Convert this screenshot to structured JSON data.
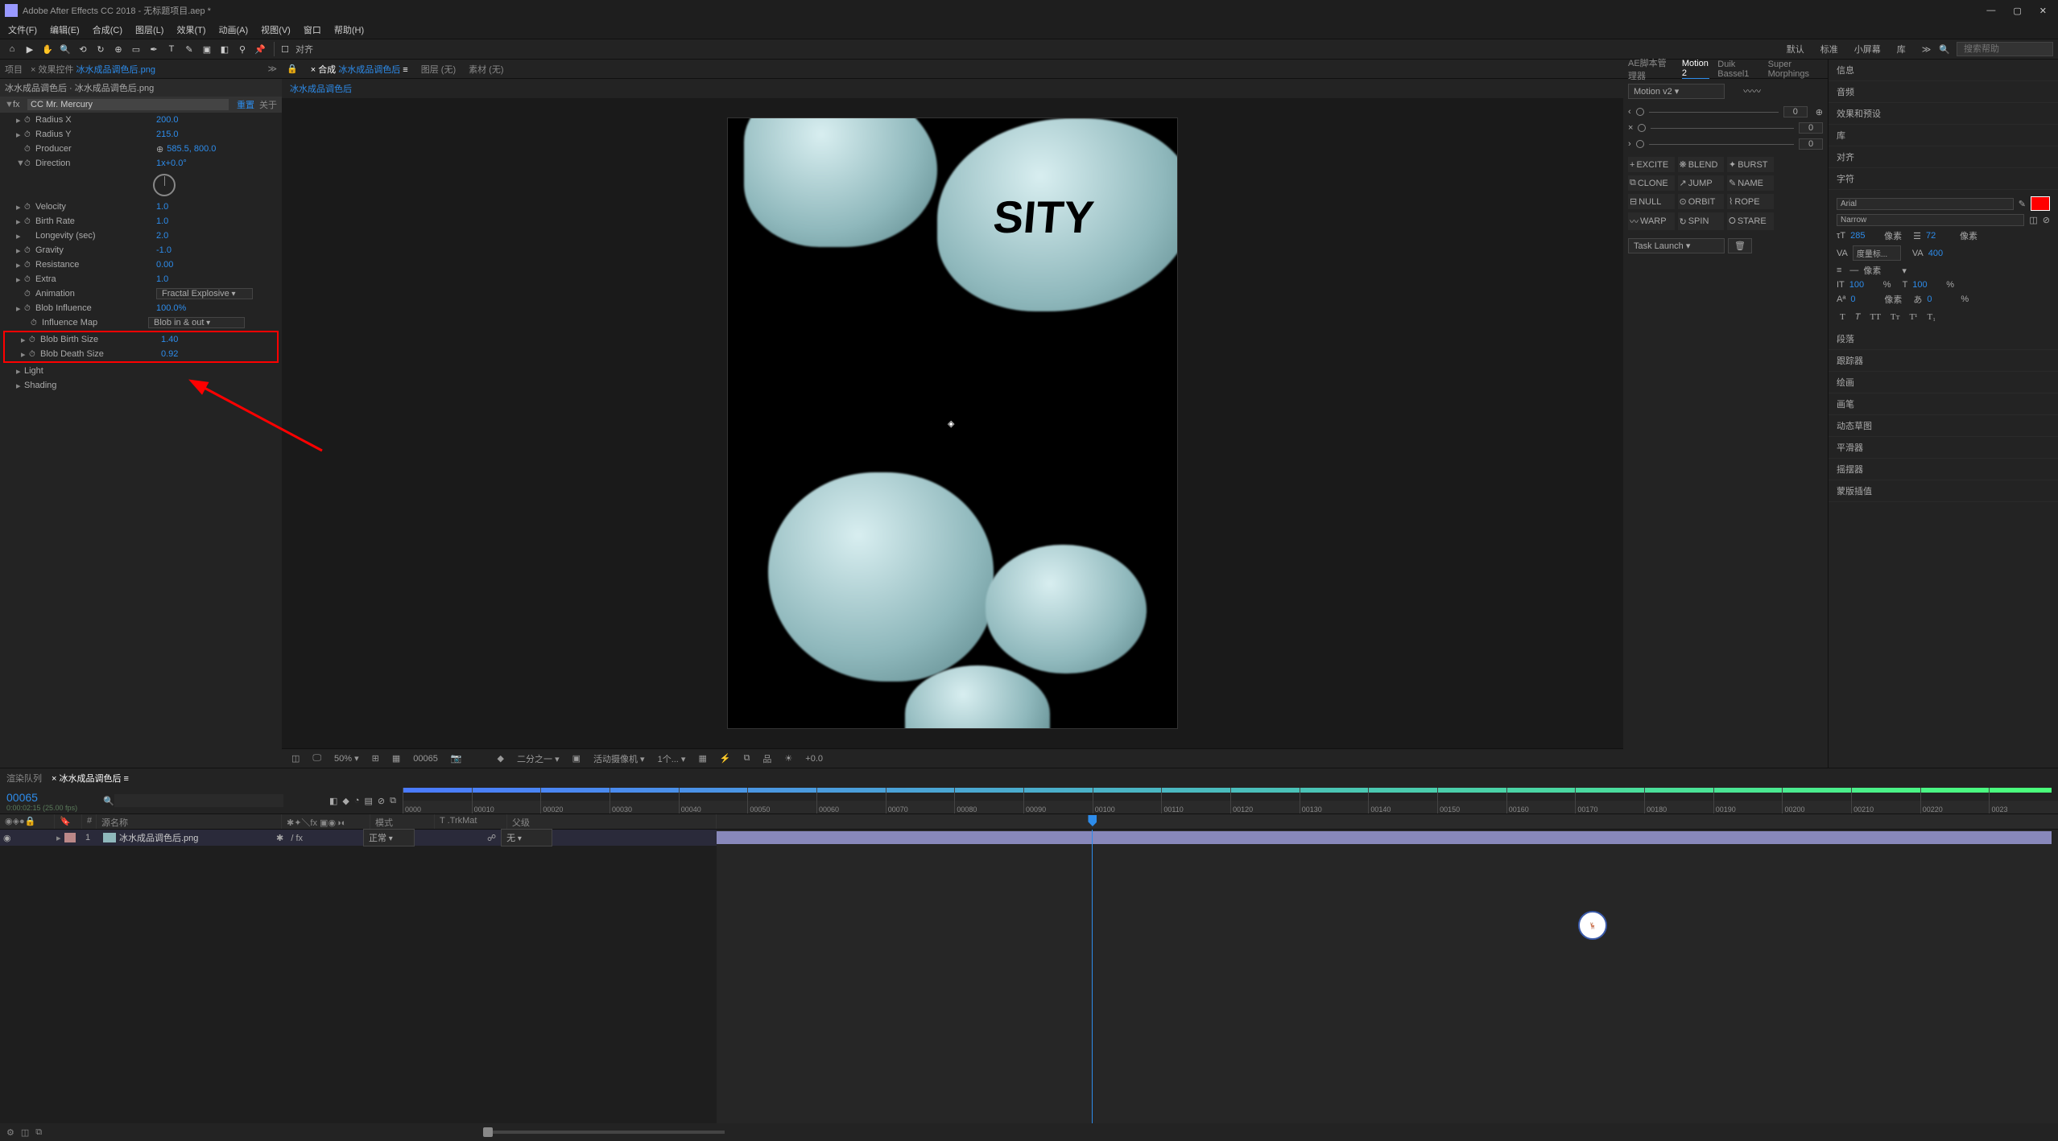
{
  "app": {
    "title": "Adobe After Effects CC 2018 - 无标题项目.aep *"
  },
  "menu": [
    "文件(F)",
    "编辑(E)",
    "合成(C)",
    "图层(L)",
    "效果(T)",
    "动画(A)",
    "视图(V)",
    "窗口",
    "帮助(H)"
  ],
  "toolbar": {
    "snap": "对齐"
  },
  "workspaces": [
    "默认",
    "标准",
    "小屏幕",
    "库"
  ],
  "search_placeholder": "搜索帮助",
  "left_panel": {
    "tabs": {
      "project": "项目",
      "effect_controls_prefix": "效果控件",
      "effect_controls_file": "冰水成品调色后.png"
    },
    "subheader": "冰水成品调色后 · 冰水成品调色后.png",
    "effect": {
      "fx": "fx",
      "name": "CC Mr. Mercury",
      "reset": "重置",
      "about": "关于"
    },
    "props": {
      "radius_x": {
        "label": "Radius X",
        "value": "200.0"
      },
      "radius_y": {
        "label": "Radius Y",
        "value": "215.0"
      },
      "producer": {
        "label": "Producer",
        "value": "585.5, 800.0"
      },
      "direction": {
        "label": "Direction",
        "value": "1x+0.0°"
      },
      "velocity": {
        "label": "Velocity",
        "value": "1.0"
      },
      "birth_rate": {
        "label": "Birth Rate",
        "value": "1.0"
      },
      "longevity": {
        "label": "Longevity (sec)",
        "value": "2.0"
      },
      "gravity": {
        "label": "Gravity",
        "value": "-1.0"
      },
      "resistance": {
        "label": "Resistance",
        "value": "0.00"
      },
      "extra": {
        "label": "Extra",
        "value": "1.0"
      },
      "animation": {
        "label": "Animation",
        "value": "Fractal Explosive"
      },
      "blob_influence": {
        "label": "Blob Influence",
        "value": "100.0%"
      },
      "influence_map": {
        "label": "Influence Map",
        "value": "Blob in & out"
      },
      "blob_birth": {
        "label": "Blob Birth Size",
        "value": "1.40"
      },
      "blob_death": {
        "label": "Blob Death Size",
        "value": "0.92"
      },
      "light": {
        "label": "Light"
      },
      "shading": {
        "label": "Shading"
      }
    }
  },
  "center_panel": {
    "tabs": {
      "comp_prefix": "合成",
      "comp_name": "冰水成品调色后",
      "layout": "图层 (无)",
      "footage": "素材 (无)"
    },
    "breadcrumb": "冰水成品调色后",
    "footer": {
      "zoom": "50%",
      "time": "00065",
      "res": "二分之一",
      "camera": "活动摄像机",
      "view": "1个...",
      "exposure": "+0.0"
    }
  },
  "right_panel": {
    "tabs": [
      "AE脚本管理器",
      "Motion 2",
      "Duik Bassel1",
      "Super Morphings"
    ],
    "active_tab": "Motion 2",
    "preset": "Motion v2",
    "slider_value": "0",
    "tools": [
      {
        "icon": "+",
        "label": "EXCITE"
      },
      {
        "icon": "❋",
        "label": "BLEND"
      },
      {
        "icon": "✦",
        "label": "BURST"
      },
      {
        "icon": "",
        "label": ""
      },
      {
        "icon": "⧉",
        "label": "CLONE"
      },
      {
        "icon": "↗",
        "label": "JUMP"
      },
      {
        "icon": "✎",
        "label": "NAME"
      },
      {
        "icon": "",
        "label": ""
      },
      {
        "icon": "⊟",
        "label": "NULL"
      },
      {
        "icon": "⊙",
        "label": "ORBIT"
      },
      {
        "icon": "⌇",
        "label": "ROPE"
      },
      {
        "icon": "",
        "label": ""
      },
      {
        "icon": "〰",
        "label": "WARP"
      },
      {
        "icon": "↻",
        "label": "SPIN"
      },
      {
        "icon": "⭘",
        "label": "STARE"
      },
      {
        "icon": "",
        "label": ""
      }
    ],
    "task_launch": "Task Launch",
    "side": [
      "信息",
      "音频",
      "效果和预设",
      "库",
      "对齐",
      "字符"
    ],
    "character": {
      "font": "Arial",
      "style": "Narrow",
      "size": "285",
      "size_unit": "像素",
      "leading": "72",
      "leading_unit": "像素",
      "kerning_opt": "度量标...",
      "tracking": "400",
      "vscale": "100",
      "hscale": "100",
      "pct": "%",
      "baseline": "0",
      "baseline_unit": "像素",
      "tsume": "0",
      "tsume_pct": "%"
    },
    "side2": [
      "段落",
      "跟踪器",
      "绘画",
      "画笔",
      "动态草图",
      "平滑器",
      "摇摆器",
      "蒙版插值"
    ]
  },
  "timeline": {
    "tabs": {
      "render": "渲染队列",
      "comp": "冰水成品调色后"
    },
    "time": "00065",
    "framerate": "0:00:02:15 (25.00 fps)",
    "search_icon": "🔍",
    "ruler": [
      "0000",
      "00010",
      "00020",
      "00030",
      "00040",
      "00050",
      "00060",
      "00070",
      "00080",
      "00090",
      "00100",
      "00110",
      "00120",
      "00130",
      "00140",
      "00150",
      "00160",
      "00170",
      "00180",
      "00190",
      "00200",
      "00210",
      "00220",
      "0023"
    ],
    "cols": {
      "src": "源名称",
      "mode": "模式",
      "trkmat": "T .TrkMat",
      "parent": "父级"
    },
    "layer": {
      "num": "1",
      "name": "冰水成品调色后.png",
      "mode": "正常",
      "parent": "无"
    }
  }
}
